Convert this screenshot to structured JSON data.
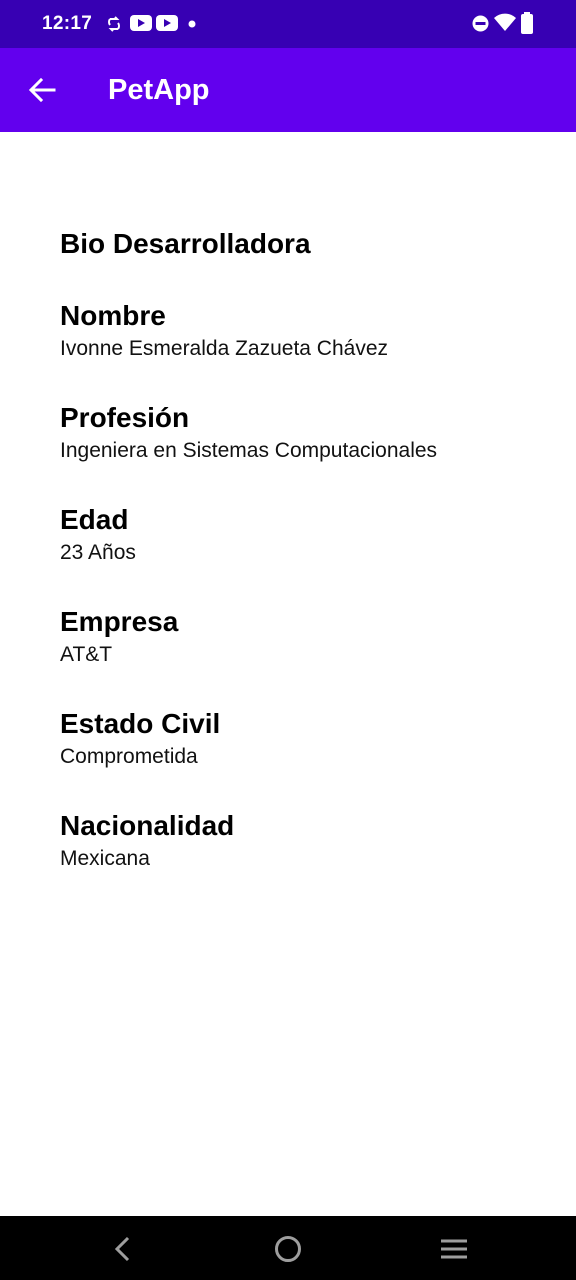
{
  "status_bar": {
    "time": "12:17",
    "left_icons": [
      "sync-icon",
      "youtube-icon",
      "youtube-icon",
      "dot-icon"
    ],
    "right_icons": [
      "do-not-disturb-icon",
      "wifi-icon",
      "battery-icon"
    ]
  },
  "app_bar": {
    "title": "PetApp",
    "back_icon": "arrow-back-icon",
    "color": "#6200ee",
    "status_color": "#3700b3"
  },
  "bio": {
    "heading": "Bio Desarrolladora",
    "fields": [
      {
        "label": "Nombre",
        "value": "Ivonne Esmeralda Zazueta Chávez"
      },
      {
        "label": "Profesión",
        "value": "Ingeniera en Sistemas Computacionales"
      },
      {
        "label": "Edad",
        "value": "23 Años"
      },
      {
        "label": "Empresa",
        "value": "AT&T"
      },
      {
        "label": "Estado Civil",
        "value": "Comprometida"
      },
      {
        "label": "Nacionalidad",
        "value": "Mexicana"
      }
    ]
  },
  "nav_bar": {
    "buttons": [
      "back-nav-icon",
      "home-nav-icon",
      "recents-nav-icon"
    ]
  }
}
